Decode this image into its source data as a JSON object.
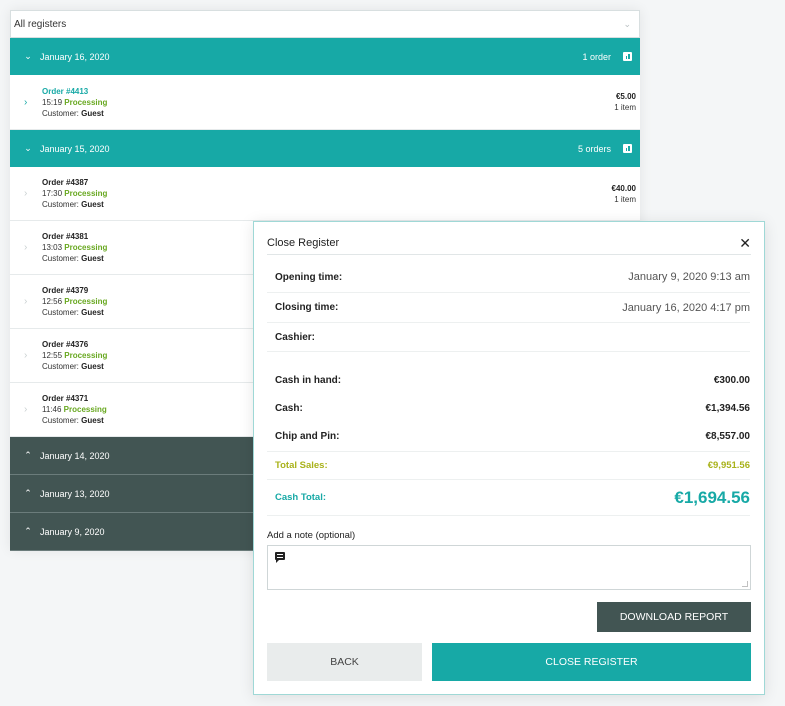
{
  "register_filter": {
    "selected": "All registers"
  },
  "days": [
    {
      "date": "January 16, 2020",
      "count": "1 order",
      "expanded": true,
      "orders": [
        {
          "number": "Order #4413",
          "time": "15:19",
          "status": "Processing",
          "customer_label": "Customer:",
          "customer": "Guest",
          "total": "€5.00",
          "items": "1 item",
          "active": true
        }
      ]
    },
    {
      "date": "January 15, 2020",
      "count": "5 orders",
      "expanded": true,
      "orders": [
        {
          "number": "Order #4387",
          "time": "17:30",
          "status": "Processing",
          "customer_label": "Customer:",
          "customer": "Guest",
          "total": "€40.00",
          "items": "1 item"
        },
        {
          "number": "Order #4381",
          "time": "13:03",
          "status": "Processing",
          "customer_label": "Customer:",
          "customer": "Guest"
        },
        {
          "number": "Order #4379",
          "time": "12:56",
          "status": "Processing",
          "customer_label": "Customer:",
          "customer": "Guest"
        },
        {
          "number": "Order #4376",
          "time": "12:55",
          "status": "Processing",
          "customer_label": "Customer:",
          "customer": "Guest"
        },
        {
          "number": "Order #4371",
          "time": "11:46",
          "status": "Processing",
          "customer_label": "Customer:",
          "customer": "Guest"
        }
      ]
    },
    {
      "date": "January 14, 2020",
      "expanded": false
    },
    {
      "date": "January 13, 2020",
      "expanded": false
    },
    {
      "date": "January 9, 2020",
      "expanded": false
    }
  ],
  "dialog": {
    "title": "Close Register",
    "rows": {
      "opening_time": {
        "label": "Opening time:",
        "value": "January 9, 2020 9:13 am"
      },
      "closing_time": {
        "label": "Closing time:",
        "value": "January 16, 2020 4:17 pm"
      },
      "cashier": {
        "label": "Cashier:",
        "value": ""
      },
      "cash_in_hand": {
        "label": "Cash in hand:",
        "value": "€300.00"
      },
      "cash": {
        "label": "Cash:",
        "value": "€1,394.56"
      },
      "chip_and_pin": {
        "label": "Chip and Pin:",
        "value": "€8,557.00"
      },
      "total_sales": {
        "label": "Total Sales:",
        "value": "€9,951.56"
      },
      "cash_total": {
        "label": "Cash Total:",
        "value": "€1,694.56"
      }
    },
    "note_label": "Add a note (optional)",
    "note_value": "",
    "download_label": "DOWNLOAD REPORT",
    "back_label": "BACK",
    "close_label": "CLOSE REGISTER"
  },
  "colors": {
    "teal": "#17a9a6",
    "dark": "#425553",
    "green": "#68a820",
    "olive": "#a9b21a"
  },
  "icons": {
    "expanded": "chevron-down-icon",
    "collapsed": "chevron-up-icon",
    "row": "chevron-right-icon",
    "report": "bar-chart-icon",
    "note": "comment-icon",
    "close": "close-icon"
  }
}
